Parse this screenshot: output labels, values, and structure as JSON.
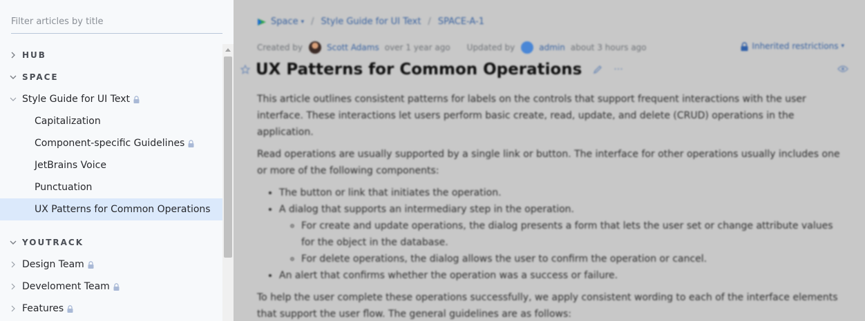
{
  "sidebar": {
    "filter_placeholder": "Filter articles by title",
    "sections": {
      "hub": "HUB",
      "space": "SPACE",
      "youtrack": "YOUTRACK"
    },
    "items": {
      "style_guide": "Style Guide for UI Text",
      "capitalization": "Capitalization",
      "component_guidelines": "Component-specific Guidelines",
      "jetbrains_voice": "JetBrains Voice",
      "punctuation": "Punctuation",
      "ux_patterns": "UX Patterns for Common Operations",
      "design_team": "Design Team",
      "development_team": "Develoment Team",
      "features": "Features"
    }
  },
  "breadcrumb": {
    "space": "Space",
    "guide": "Style Guide for UI Text",
    "id": "SPACE-A-1"
  },
  "meta": {
    "created_label": "Created by",
    "created_user": "Scott Adams",
    "created_time": "over 1 year ago",
    "updated_label": "Updated by",
    "updated_user": "admin",
    "updated_time": "about 3 hours ago",
    "restrictions": "Inherited restrictions"
  },
  "article": {
    "title": "UX Patterns for Common Operations",
    "p1": "This article outlines consistent patterns for labels on the controls that support frequent interactions with the user interface. These interactions let users perform basic create, read, update, and delete (CRUD) operations in the application.",
    "p2": "Read operations are usually supported by a single link or button. The interface for other operations usually includes one or more of the following components:",
    "li1": "The button or link that initiates the operation.",
    "li2": "A dialog that supports an intermediary step in the operation.",
    "li2a": "For create and update operations, the dialog presents a form that lets the user set or change attribute values for the object in the database.",
    "li2b": "For delete operations, the dialog allows the user to confirm the operation or cancel.",
    "li3": "An alert that confirms whether the operation was a success or failure.",
    "p3": "To help the user complete these operations successfully, we apply consistent wording to each of the interface elements that support the user flow. The general guidelines are as follows:"
  },
  "colors": {
    "selected_bg": "#dbe9fb",
    "link": "#3a63a0",
    "overlay": "#c8c8c8"
  }
}
